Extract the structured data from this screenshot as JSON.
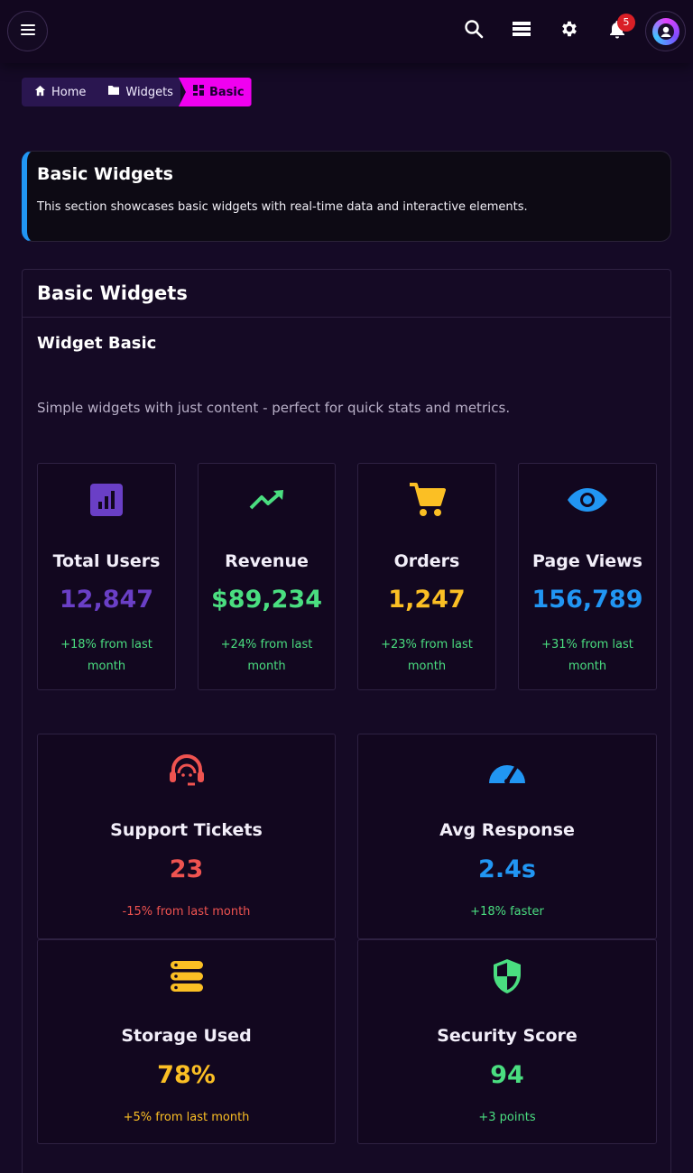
{
  "topbar": {
    "notification_count": "5"
  },
  "breadcrumb": {
    "items": [
      {
        "label": "Home",
        "icon": "home-icon"
      },
      {
        "label": "Widgets",
        "icon": "folder-icon"
      },
      {
        "label": "Basic",
        "icon": "dashboard-icon"
      }
    ]
  },
  "alert": {
    "title": "Basic Widgets",
    "text": "This section showcases basic widgets with real-time data and interactive elements.",
    "accent": "#2196f3"
  },
  "card": {
    "title": "Basic Widgets",
    "subtitle": "Widget Basic",
    "description": "Simple widgets with just content - perfect for quick stats and metrics."
  },
  "widgets": [
    {
      "label": "Total Users",
      "value": "12,847",
      "note": "+18% from last month",
      "color": "#6a3fc6",
      "note_color": "#4ade80",
      "icon": "bar-chart-icon"
    },
    {
      "label": "Revenue",
      "value": "$89,234",
      "note": "+24% from last month",
      "color": "#4ade80",
      "note_color": "#4ade80",
      "icon": "trending-up-icon"
    },
    {
      "label": "Orders",
      "value": "1,247",
      "note": "+23% from last month",
      "color": "#fbbf24",
      "note_color": "#4ade80",
      "icon": "shopping-cart-icon"
    },
    {
      "label": "Page Views",
      "value": "156,789",
      "note": "+31% from last month",
      "color": "#2196f3",
      "note_color": "#4ade80",
      "icon": "eye-icon"
    },
    {
      "label": "Support Tickets",
      "value": "23",
      "note": "-15% from last month",
      "color": "#ef5350",
      "note_color": "#ef5350",
      "icon": "headset-icon"
    },
    {
      "label": "Avg Response",
      "value": "2.4s",
      "note": "+18% faster",
      "color": "#2196f3",
      "note_color": "#4ade80",
      "icon": "speedometer-icon"
    },
    {
      "label": "Storage Used",
      "value": "78%",
      "note": "+5% from last month",
      "color": "#fbbf24",
      "note_color": "#fbbf24",
      "icon": "storage-icon"
    },
    {
      "label": "Security Score",
      "value": "94",
      "note": "+3 points",
      "color": "#4ade80",
      "note_color": "#4ade80",
      "icon": "shield-icon"
    }
  ]
}
